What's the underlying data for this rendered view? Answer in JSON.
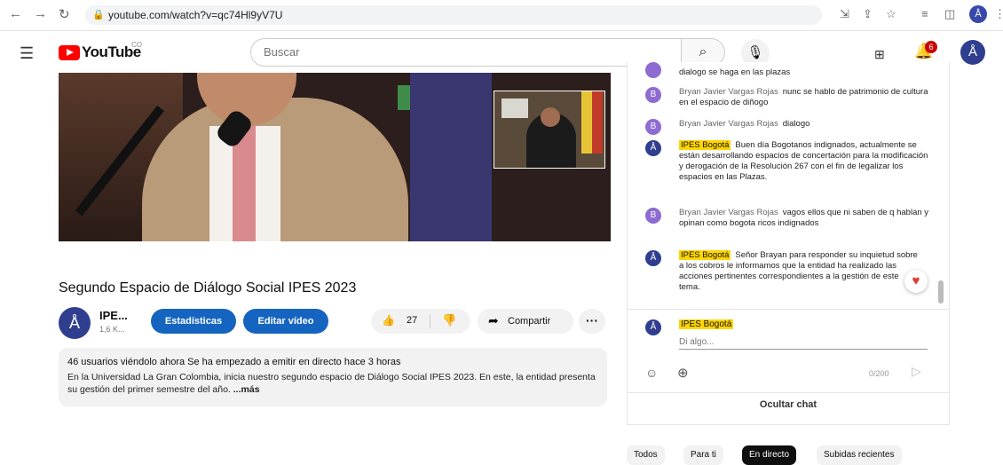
{
  "browser": {
    "url": "youtube.com/watch?v=qc74Hl9yV7U"
  },
  "masthead": {
    "logo_text": "YouTube",
    "country_code": "CO",
    "search_placeholder": "Buscar",
    "notification_count": "6"
  },
  "video": {
    "title": "Segundo Espacio de Diálogo Social IPES 2023",
    "channel_name": "IPE...",
    "channel_subs": "1,6 K...",
    "stats_button": "Estadísticas",
    "edit_button": "Editar vídeo",
    "likes": "27",
    "share_label": "Compartir",
    "more_label": "···"
  },
  "description": {
    "line1": "46 usuarios viéndolo ahora  Se ha empezado a emitir en directo hace 3 horas",
    "line2": "En la Universidad La Gran Colombia, inicia nuestro segundo espacio de Diálogo Social IPES 2023. En este, la entidad presenta su gestión del primer semestre del año. ",
    "more": "...más"
  },
  "chat": {
    "messages": [
      {
        "author": "",
        "text": "dialogo se haga en las plazas"
      },
      {
        "author": "Bryan Javier Vargas Rojas",
        "text": "nunc se hablo de patrimonio de cultura en el espacio de diñogo"
      },
      {
        "author": "Bryan Javier Vargas Rojas",
        "text": "dialogo"
      },
      {
        "author": "IPES Bogotá",
        "text": "Buen día Bogotanos indignados, actualmente se están desarrollando espacios de concertación para la modificación y derogación de la Resolución 267 con el fin de legalizar los espacios en las Plazas."
      },
      {
        "author": "Bryan Javier Vargas Rojas",
        "text": "vagos ellos que ni saben de q hablan y opinan como bogota ricos indignados"
      },
      {
        "author": "IPES Bogotá",
        "text": "Señor Brayan para responder su inquietud sobre a los cobros le informamos que la entidad ha realizado las acciones pertinentes correspondientes a la gestión de este tema."
      }
    ],
    "avatar_letter": "B",
    "composer_name": "IPES Bogotá",
    "composer_placeholder": "Di algo...",
    "char_count": "0/200",
    "hide_chat": "Ocultar chat"
  },
  "chips": [
    "Todos",
    "Para ti",
    "En directo",
    "Subidas recientes"
  ],
  "colors": {
    "brand_red": "#ff0000",
    "button_blue": "#1565c0",
    "owner_highlight": "#ffd600",
    "avatar_purple": "#8e6bd1",
    "channel_navy": "#2f3e8f"
  }
}
